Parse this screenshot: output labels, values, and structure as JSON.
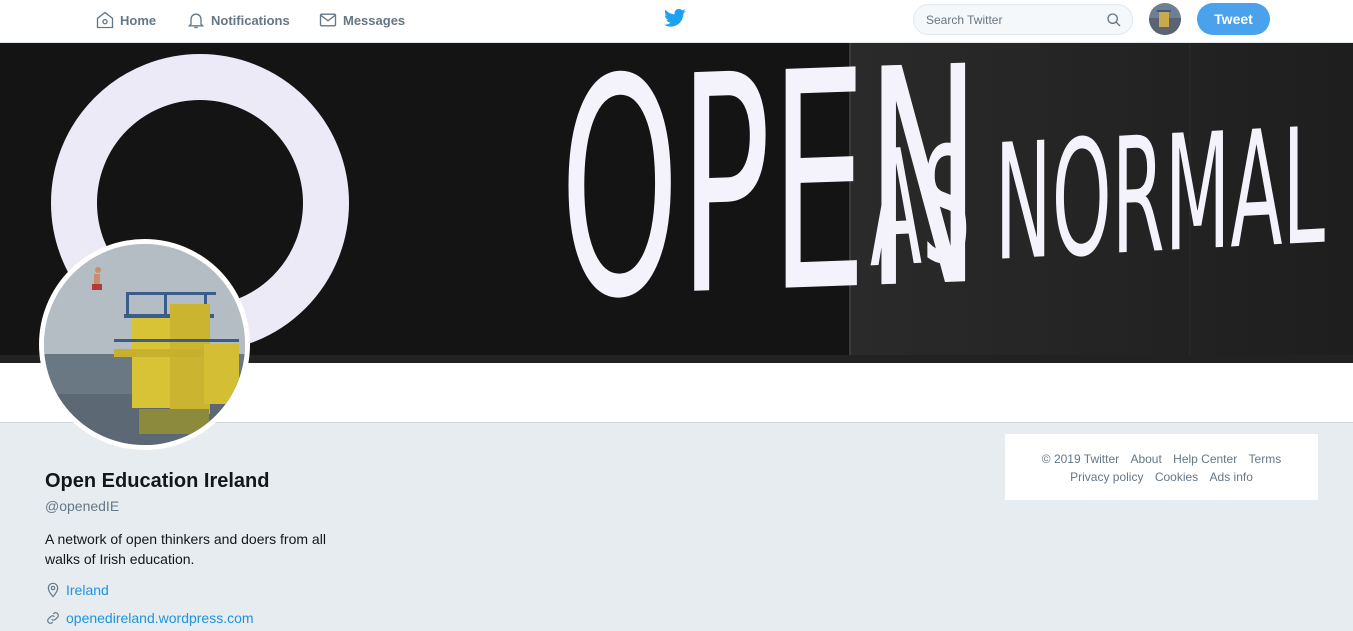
{
  "nav": {
    "home": "Home",
    "notifications": "Notifications",
    "messages": "Messages"
  },
  "search": {
    "placeholder": "Search Twitter"
  },
  "tweet_button": "Tweet",
  "banner": {
    "line_open": "OPEN",
    "line_as_normal": "AS NORMAL"
  },
  "profile": {
    "name": "Open Education Ireland",
    "handle": "@openedIE",
    "bio": "A network of open thinkers and doers from all walks of Irish education.",
    "location": "Ireland",
    "website": "openedireland.wordpress.com"
  },
  "footer": {
    "copyright": "© 2019 Twitter",
    "about": "About",
    "help_center": "Help Center",
    "terms": "Terms",
    "privacy": "Privacy policy",
    "cookies": "Cookies",
    "ads_info": "Ads info"
  },
  "colors": {
    "accent": "#1da1f2",
    "tweet_button": "#4aa1ec",
    "background": "#e6ecf0"
  },
  "icons": [
    "home-icon",
    "bell-icon",
    "envelope-icon",
    "twitter-bird-icon",
    "search-icon",
    "location-pin-icon",
    "link-icon"
  ]
}
